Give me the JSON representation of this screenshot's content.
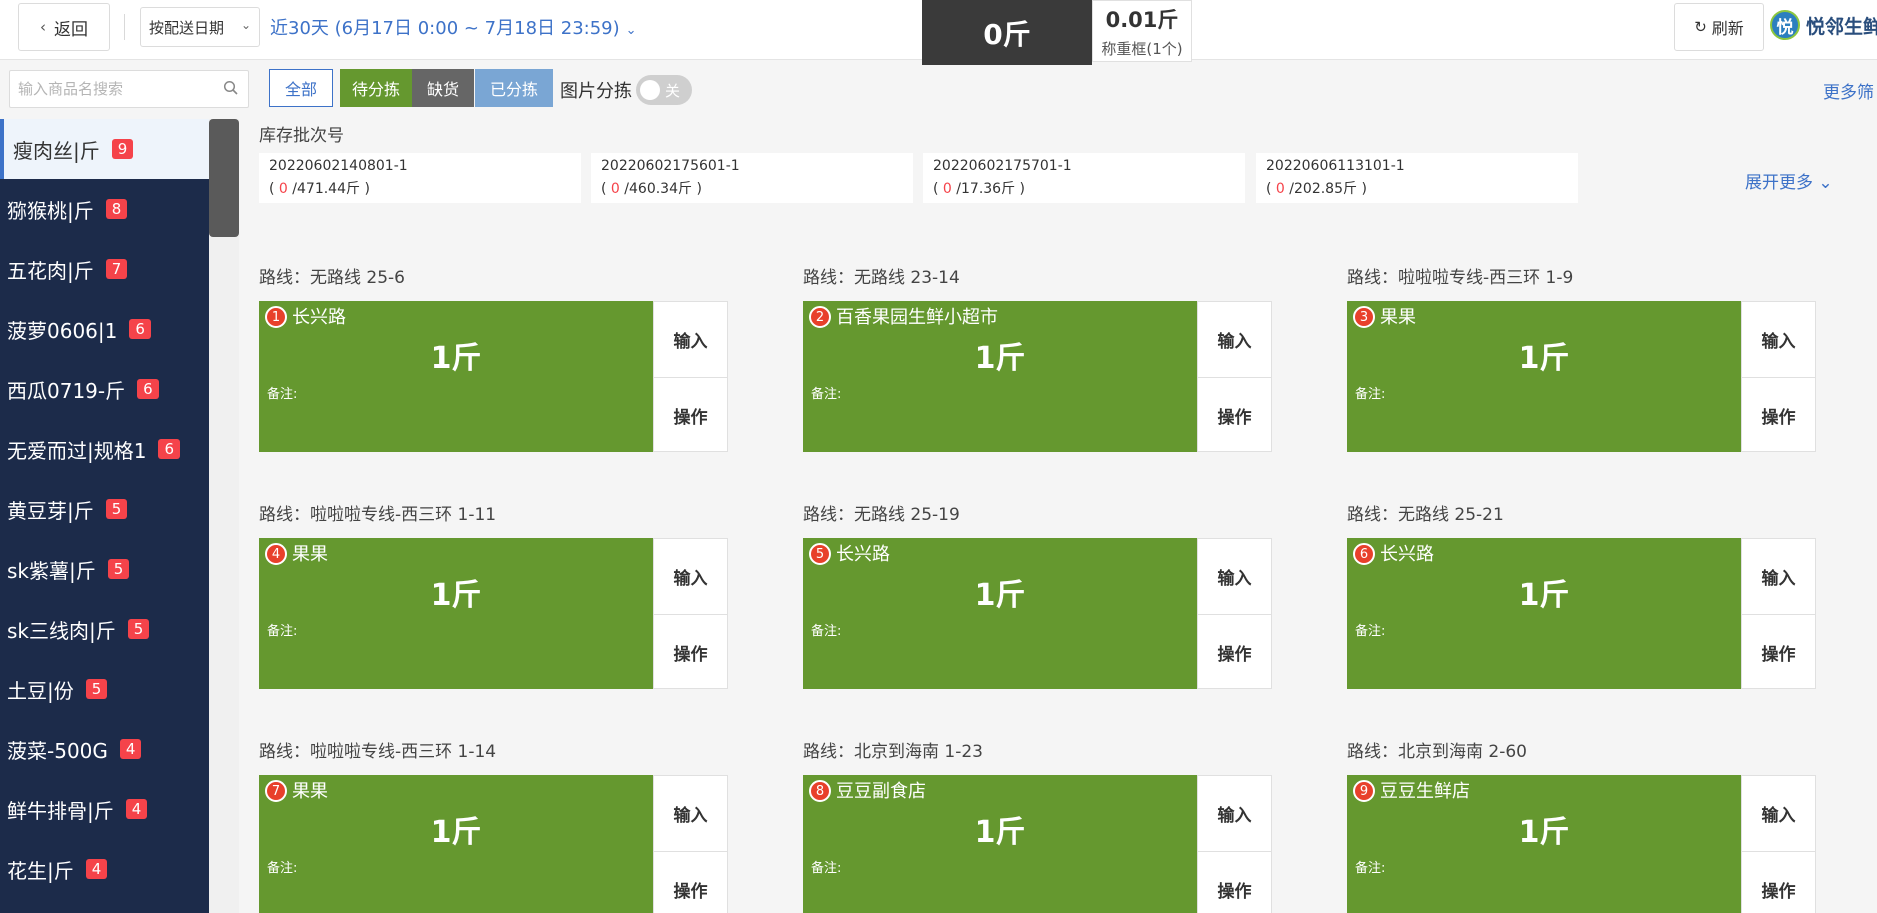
{
  "header": {
    "back_label": "返回",
    "date_filter": "按配送日期",
    "date_range": "近30天 (6月17日 0:00 ~ 7月18日 23:59)",
    "weight_display": "0斤",
    "scale_value": "0.01斤",
    "scale_label": "称重框(1个)",
    "refresh_label": "刷新",
    "brand_logo_char": "悦",
    "brand_name": "悦邻生鲜"
  },
  "search": {
    "placeholder": "输入商品名搜索"
  },
  "sidebar": {
    "items": [
      {
        "label": "瘦肉丝|斤",
        "count": "9"
      },
      {
        "label": "猕猴桃|斤",
        "count": "8"
      },
      {
        "label": "五花肉|斤",
        "count": "7"
      },
      {
        "label": "菠萝0606|1",
        "count": "6"
      },
      {
        "label": "西瓜0719-斤",
        "count": "6"
      },
      {
        "label": "无爱而过|规格1",
        "count": "6"
      },
      {
        "label": "黄豆芽|斤",
        "count": "5"
      },
      {
        "label": "sk紫薯|斤",
        "count": "5"
      },
      {
        "label": "sk三线肉|斤",
        "count": "5"
      },
      {
        "label": "土豆|份",
        "count": "5"
      },
      {
        "label": "菠菜-500G",
        "count": "4"
      },
      {
        "label": "鲜牛排骨|斤",
        "count": "4"
      },
      {
        "label": "花生|斤",
        "count": "4"
      }
    ]
  },
  "filters": {
    "tabs": [
      "全部",
      "待分拣",
      "缺货",
      "已分拣"
    ],
    "image_sort_label": "图片分拣",
    "toggle_text": "关",
    "more_label": "更多筛"
  },
  "batch": {
    "title": "库存批次号",
    "items": [
      {
        "id": "20220602140801-1",
        "used": "0",
        "total": "/471.44斤"
      },
      {
        "id": "20220602175601-1",
        "used": "0",
        "total": "/460.34斤"
      },
      {
        "id": "20220602175701-1",
        "used": "0",
        "total": "/17.36斤"
      },
      {
        "id": "20220606113101-1",
        "used": "0",
        "total": "/202.85斤"
      }
    ],
    "expand_label": "展开更多"
  },
  "orders": {
    "input_label": "输入",
    "action_label": "操作",
    "note_label": "备注:",
    "items": [
      {
        "route": "路线：无路线 25-6",
        "num": "1",
        "shop": "长兴路",
        "qty": "1斤"
      },
      {
        "route": "路线：无路线 23-14",
        "num": "2",
        "shop": "百香果园生鲜小超市",
        "qty": "1斤"
      },
      {
        "route": "路线：啦啦啦专线-西三环 1-9",
        "num": "3",
        "shop": "果果",
        "qty": "1斤"
      },
      {
        "route": "路线：啦啦啦专线-西三环 1-11",
        "num": "4",
        "shop": "果果",
        "qty": "1斤"
      },
      {
        "route": "路线：无路线 25-19",
        "num": "5",
        "shop": "长兴路",
        "qty": "1斤"
      },
      {
        "route": "路线：无路线 25-21",
        "num": "6",
        "shop": "长兴路",
        "qty": "1斤"
      },
      {
        "route": "路线：啦啦啦专线-西三环 1-14",
        "num": "7",
        "shop": "果果",
        "qty": "1斤"
      },
      {
        "route": "路线：北京到海南 1-23",
        "num": "8",
        "shop": "豆豆副食店",
        "qty": "1斤"
      },
      {
        "route": "路线：北京到海南 2-60",
        "num": "9",
        "shop": "豆豆生鲜店",
        "qty": "1斤"
      }
    ]
  },
  "colors": {
    "sidebar_bg": "#1c2b4a",
    "card_green": "#65982f",
    "accent_blue": "#3d72c8",
    "badge_red": "#f5434a"
  }
}
